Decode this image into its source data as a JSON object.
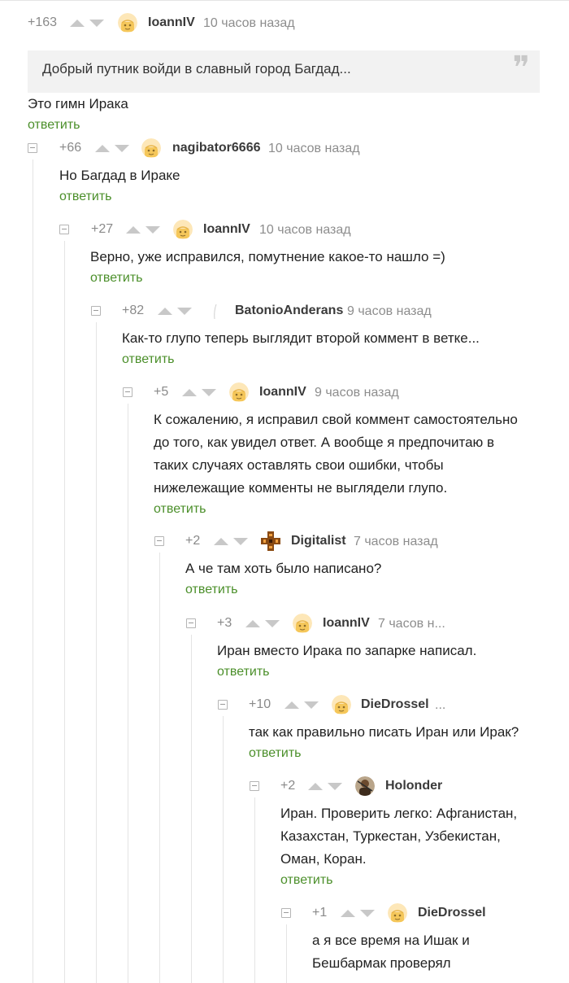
{
  "comments": [
    {
      "rating": "+163",
      "username": "IoannIV",
      "time": "10 часов назад",
      "quote": "Добрый путник войди в славный город Багдад...",
      "text": "Это гимн Ирака",
      "reply": "ответить"
    },
    {
      "rating": "+66",
      "username": "nagibator6666",
      "time": "10 часов назад",
      "text": "Но Багдад в Ираке",
      "reply": "ответить"
    },
    {
      "rating": "+27",
      "username": "IoannIV",
      "time": "10 часов назад",
      "text": "Верно, уже исправился, помутнение какое-то нашло =)",
      "reply": "ответить"
    },
    {
      "rating": "+82",
      "username": "BatonioAnderans",
      "time": "9 часов назад",
      "text": "Как-то глупо теперь выглядит второй коммент в ветке...",
      "reply": "ответить"
    },
    {
      "rating": "+5",
      "username": "IoannIV",
      "time": "9 часов назад",
      "text_lines": [
        "К сожалению, я исправил свой коммент самостоятельно",
        "до того, как увидел ответ. А вообще я предпочитаю в",
        "таких случаях оставлять свои ошибки, чтобы",
        "нижележащие комменты не выглядели глупо."
      ],
      "reply": "ответить"
    },
    {
      "rating": "+2",
      "username": "Digitalist",
      "time": "7 часов назад",
      "text": "А че там хоть было написано?",
      "reply": "ответить"
    },
    {
      "rating": "+3",
      "username": "IoannIV",
      "time": "7 часов н...",
      "text": "Иран вместо Ирака по запарке написал.",
      "reply": "ответить"
    },
    {
      "rating": "+10",
      "username": "DieDrossel",
      "time": "...",
      "text": "так как правильно писать Иран или Ирак?",
      "reply": "ответить"
    },
    {
      "rating": "+2",
      "username": "Holonder",
      "time": "",
      "text_lines": [
        "Иран. Проверить легко: Афганистан,",
        "Казахстан, Туркестан, Узбекистан,",
        "Оман, Коран."
      ],
      "reply": "ответить"
    },
    {
      "rating": "+1",
      "username": "DieDrossel",
      "time": "",
      "text_lines": [
        "а я все время на Ишак и",
        "Бешбармак проверял"
      ]
    }
  ],
  "icons": {
    "collapse": "minus-square-icon",
    "vote_up": "triangle-up-icon",
    "vote_down": "triangle-down-icon",
    "quote": "quote-mark-icon",
    "avatar_default": "default-face-avatar",
    "avatar_digitalist": "cross-pattern-avatar",
    "avatar_holonder": "photo-avatar",
    "avatar_empty": "blank-avatar"
  },
  "colors": {
    "accent_green": "#4b8f2a",
    "muted_text": "#8d8d8d",
    "vote_arrow": "#c8c8c8",
    "quote_bg": "#f2f2f2"
  }
}
